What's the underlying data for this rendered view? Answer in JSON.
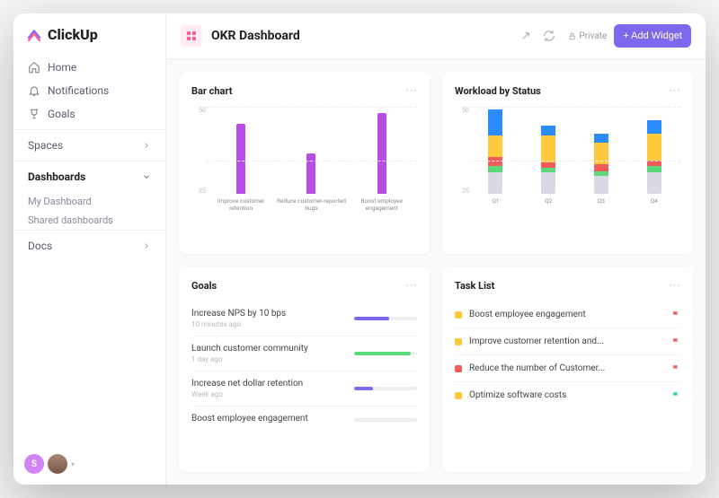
{
  "brand": "ClickUp",
  "sidebar": {
    "home": "Home",
    "notifications": "Notifications",
    "goals": "Goals",
    "spaces": "Spaces",
    "dashboards": "Dashboards",
    "my_dashboard": "My Dashboard",
    "shared_dashboards": "Shared dashboards",
    "docs": "Docs",
    "avatar_initial": "S"
  },
  "header": {
    "title": "OKR Dashboard",
    "private": "Private",
    "add_widget": "+ Add Widget"
  },
  "cards": {
    "bar_chart": {
      "title": "Bar chart"
    },
    "workload": {
      "title": "Workload by Status"
    },
    "goals": {
      "title": "Goals"
    },
    "tasks": {
      "title": "Task List"
    }
  },
  "chart_data": [
    {
      "id": "bar_chart",
      "type": "bar",
      "ylim": [
        0,
        50
      ],
      "yticks": [
        50,
        25
      ],
      "categories": [
        "Improve customer retention",
        "Reduce customer-reported bugs",
        "Boost employee engagement"
      ],
      "values": [
        40,
        23,
        46
      ],
      "color": "#b84ce6"
    },
    {
      "id": "workload",
      "type": "stacked_bar",
      "ylim": [
        0,
        50
      ],
      "yticks": [
        50,
        25
      ],
      "categories": [
        "Q1",
        "Q2",
        "Q3",
        "Q4"
      ],
      "series": [
        {
          "name": "gray",
          "color": "#d9d9e3",
          "values": [
            12,
            12,
            10,
            12
          ]
        },
        {
          "name": "green",
          "color": "#5bd97b",
          "values": [
            4,
            3,
            3,
            4
          ]
        },
        {
          "name": "red",
          "color": "#f25c5c",
          "values": [
            5,
            3,
            4,
            3
          ]
        },
        {
          "name": "yellow",
          "color": "#ffc93c",
          "values": [
            12,
            15,
            12,
            15
          ]
        },
        {
          "name": "blue",
          "color": "#2a8cff",
          "values": [
            15,
            6,
            5,
            8
          ]
        }
      ]
    }
  ],
  "goals": [
    {
      "name": "Increase NPS by 10 bps",
      "time": "10 minutes ago",
      "progress": 55,
      "color": "#7b68ee"
    },
    {
      "name": "Launch customer community",
      "time": "1 day ago",
      "progress": 90,
      "color": "#5bd97b"
    },
    {
      "name": "Increase net dollar retention",
      "time": "Week ago",
      "progress": 30,
      "color": "#7b68ee"
    },
    {
      "name": "Boost employee engagement",
      "time": "",
      "progress": 0,
      "color": "#ccc"
    }
  ],
  "tasks": [
    {
      "name": "Boost employee engagement",
      "status_color": "#ffc93c",
      "flag_color": "#f25c5c"
    },
    {
      "name": "Improve customer retention and...",
      "status_color": "#ffc93c",
      "flag_color": "#f25c5c"
    },
    {
      "name": "Reduce the number of Customer...",
      "status_color": "#f25c5c",
      "flag_color": "#f25c5c"
    },
    {
      "name": "Optimize software costs",
      "status_color": "#ffc93c",
      "flag_color": "#2ecfb0"
    }
  ]
}
